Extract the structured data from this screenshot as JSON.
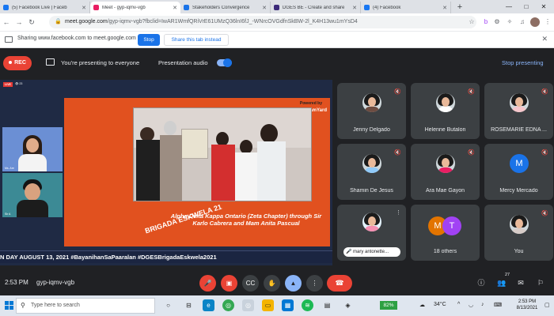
{
  "browser": {
    "tabs": [
      {
        "label": "(5) Facebook Live | Faceb",
        "color": "#1877f2",
        "active": false
      },
      {
        "label": "Meet - gyp-iqmv-vgb",
        "color": "#e91e63",
        "active": true
      },
      {
        "label": "Stakeholders Convergence",
        "color": "#1a73e8",
        "active": false
      },
      {
        "label": "DGES BE - Create and share",
        "color": "#3d2b7a",
        "active": false
      },
      {
        "label": "(4) Facebook",
        "color": "#1877f2",
        "active": false
      }
    ],
    "url_host": "meet.google.com",
    "url_path": "/gyp-iqmv-vgb?fbclid=IwAR1WmfQRiVrE61UMzQ36lnI6fJ_-WNrcOVGdfnSkBW-2l_K4H13wu1mYsD4"
  },
  "share_bar": {
    "text": "Sharing www.facebook.com to meet.google.com",
    "stop_label": "Stop",
    "hide_label": "Share this tab instead"
  },
  "meet": {
    "rec_label": "REC",
    "presenting_text": "You're presenting to everyone",
    "presentation_audio": "Presentation audio",
    "stop_presenting": "Stop presenting",
    "time": "2:53 PM",
    "meeting_code": "gyp-iqmv-vgb",
    "people_count": "27"
  },
  "stream": {
    "live": "LIVE",
    "viewers": "👁 23",
    "powered_by": "Powered by",
    "streamyard": "StreamYard",
    "side_names": [
      "Ms. Are",
      "Sir A"
    ],
    "caption": "Alpha Delta Kappa Ontario (Zeta Chapter) through Sir Karlo Cabrera and Mam Anita Pascual",
    "brigada": "BRIGADA ESKWELA 21",
    "ticker": "N DAY AUGUST 13, 2021 #BayanihanSaPaaralan #DGESBrigadaEskwela2021"
  },
  "participants": [
    {
      "name": "Jenny Delgado",
      "kind": "photo",
      "body": "#6d4c41"
    },
    {
      "name": "Helenne Butalon",
      "kind": "photo",
      "body": "#ffffff"
    },
    {
      "name": "ROSEMARIE EDNA ...",
      "kind": "photo",
      "body": "#f5c6cb"
    },
    {
      "name": "Shamin De Jesus",
      "kind": "photo",
      "body": "#90caf9"
    },
    {
      "name": "Ara Mae Gayon",
      "kind": "photo",
      "body": "#e91e63"
    },
    {
      "name": "Mercy Mercado",
      "kind": "letter",
      "letter": "M",
      "color": "#1a73e8"
    },
    {
      "name": "mary antonette...",
      "kind": "chip",
      "body": "#f48fb1"
    },
    {
      "name": "18 others",
      "kind": "others",
      "letters": [
        "M",
        "T"
      ],
      "colors": [
        "#e37400",
        "#a142f4"
      ]
    },
    {
      "name": "You",
      "kind": "photo",
      "body": "#d7ccc8"
    }
  ],
  "taskbar": {
    "search_placeholder": "Type here to search",
    "battery": "82%",
    "temperature": "34°C",
    "clock_time": "2:53 PM",
    "clock_date": "8/13/2021"
  }
}
